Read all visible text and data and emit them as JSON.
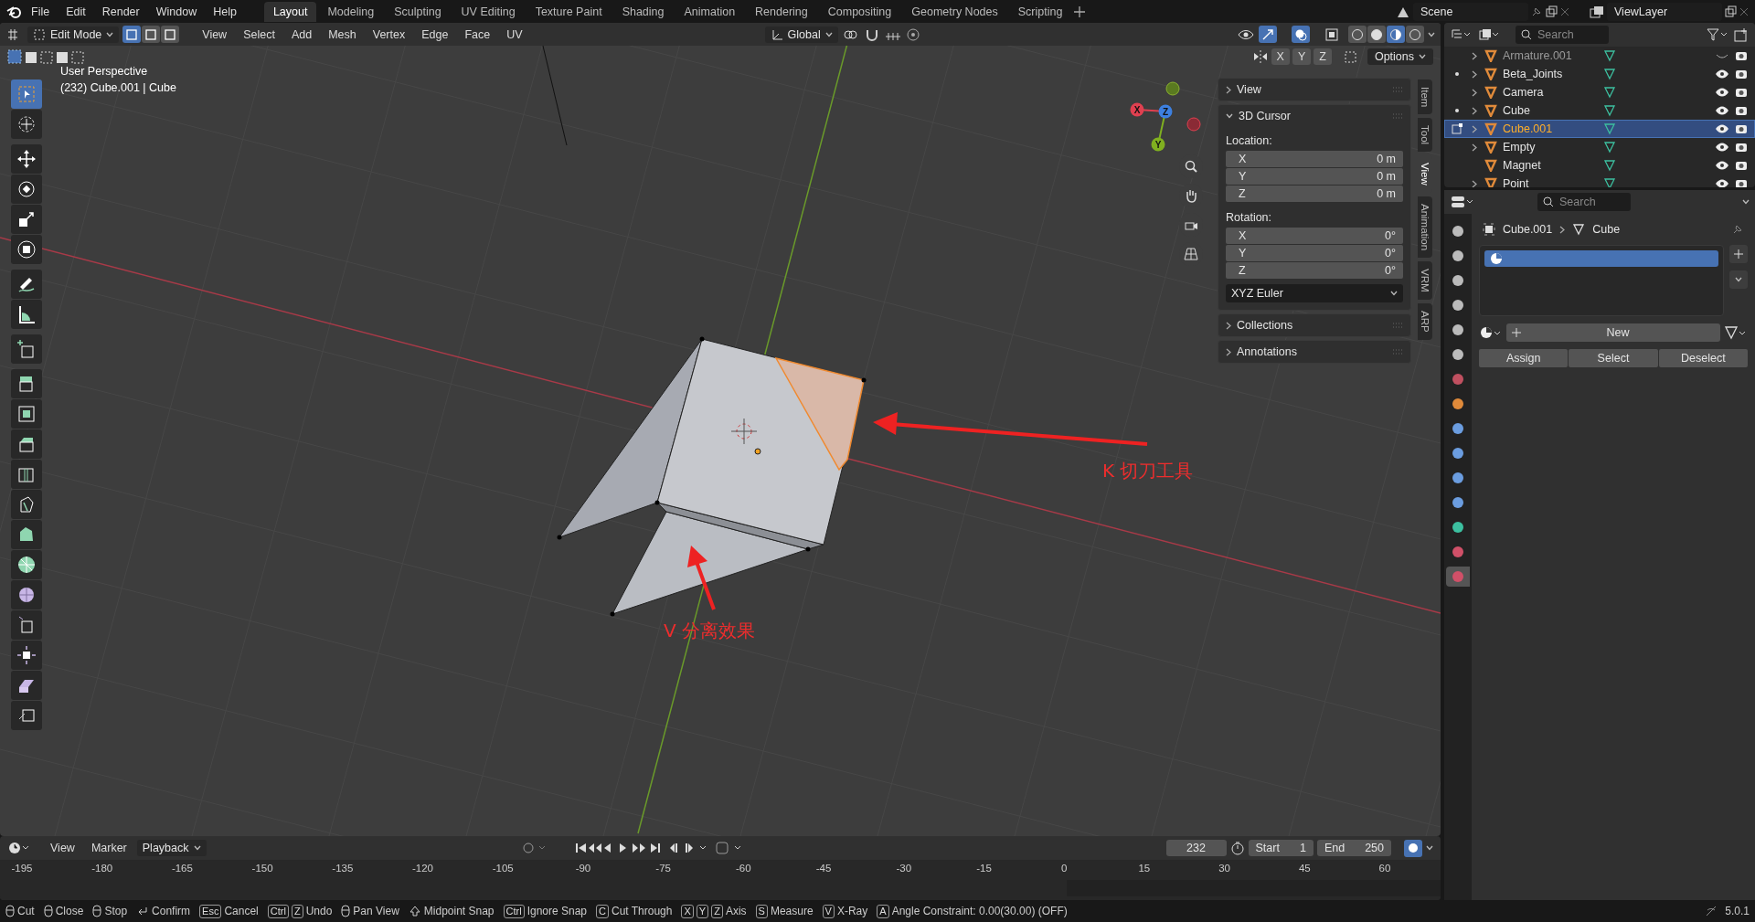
{
  "menu": [
    "File",
    "Edit",
    "Render",
    "Window",
    "Help"
  ],
  "workspaces": [
    {
      "label": "Layout",
      "selected": true
    },
    {
      "label": "Modeling",
      "selected": false
    },
    {
      "label": "Sculpting",
      "selected": false
    },
    {
      "label": "UV Editing",
      "selected": false
    },
    {
      "label": "Texture Paint",
      "selected": false
    },
    {
      "label": "Shading",
      "selected": false
    },
    {
      "label": "Animation",
      "selected": false
    },
    {
      "label": "Rendering",
      "selected": false
    },
    {
      "label": "Compositing",
      "selected": false
    },
    {
      "label": "Geometry Nodes",
      "selected": false
    },
    {
      "label": "Scripting",
      "selected": false
    }
  ],
  "scene": "Scene",
  "view_layer": "ViewLayer",
  "viewport": {
    "mode": "Edit Mode",
    "select_modes": [
      {
        "selected": true
      },
      {
        "selected": false
      },
      {
        "selected": false
      }
    ],
    "menus": [
      "View",
      "Select",
      "Add",
      "Mesh",
      "Vertex",
      "Edge",
      "Face",
      "UV"
    ],
    "orientation": "Global",
    "gizmos_on": true,
    "overlays_on": true,
    "shading": [
      {
        "selected": false
      },
      {
        "selected": false
      },
      {
        "selected": true
      },
      {
        "selected": false
      }
    ],
    "mirror_axes": [
      "X",
      "Y",
      "Z"
    ],
    "options": "Options",
    "view_name": "User Perspective",
    "object_info": "(232) Cube.001 | Cube",
    "gizmo_axes": [
      "X",
      "Y",
      "Z"
    ],
    "annotations": [
      "K 切刀工具",
      "V 分离效果"
    ],
    "tools": [
      {
        "selected": true
      },
      {
        "selected": false
      },
      {
        "selected": false
      },
      {
        "selected": false
      },
      {
        "selected": false
      },
      {
        "selected": false
      },
      {
        "selected": false
      },
      {
        "selected": false
      },
      {
        "selected": false
      },
      {
        "selected": false
      },
      {
        "selected": false
      },
      {
        "selected": false
      },
      {
        "selected": false
      },
      {
        "selected": false
      },
      {
        "selected": false
      },
      {
        "selected": false
      },
      {
        "selected": false
      },
      {
        "selected": false
      },
      {
        "selected": false
      },
      {
        "selected": false
      },
      {
        "selected": false
      }
    ],
    "sidebar": {
      "tabs": [
        {
          "label": "Item",
          "selected": false
        },
        {
          "label": "Tool",
          "selected": false
        },
        {
          "label": "View",
          "selected": true
        },
        {
          "label": "Animation",
          "selected": false
        },
        {
          "label": "VRM",
          "selected": false
        },
        {
          "label": "ARP",
          "selected": false
        }
      ],
      "sections": [
        {
          "title": "View",
          "expanded": false
        },
        {
          "title": "3D Cursor",
          "expanded": true,
          "groups": [
            {
              "label": "Location:",
              "rows": [
                {
                  "axis": "X",
                  "value": "0 m"
                },
                {
                  "axis": "Y",
                  "value": "0 m"
                },
                {
                  "axis": "Z",
                  "value": "0 m"
                }
              ]
            },
            {
              "label": "Rotation:",
              "rows": [
                {
                  "axis": "X",
                  "value": "0°"
                },
                {
                  "axis": "Y",
                  "value": "0°"
                },
                {
                  "axis": "Z",
                  "value": "0°"
                }
              ]
            }
          ],
          "rotation_mode": "XYZ Euler"
        },
        {
          "title": "Collections",
          "expanded": false
        },
        {
          "title": "Annotations",
          "expanded": false
        }
      ]
    }
  },
  "outliner": {
    "search_placeholder": "Search",
    "items": [
      {
        "name": "Armature.001",
        "selected": false,
        "visible": false,
        "expandable": true,
        "dot": false,
        "editing": false
      },
      {
        "name": "Beta_Joints",
        "selected": false,
        "visible": true,
        "expandable": true,
        "dot": true,
        "editing": false
      },
      {
        "name": "Camera",
        "selected": false,
        "visible": true,
        "expandable": true,
        "dot": false,
        "editing": false
      },
      {
        "name": "Cube",
        "selected": false,
        "visible": true,
        "expandable": true,
        "dot": true,
        "editing": false
      },
      {
        "name": "Cube.001",
        "selected": true,
        "visible": true,
        "expandable": true,
        "dot": false,
        "editing": true
      },
      {
        "name": "Empty",
        "selected": false,
        "visible": true,
        "expandable": true,
        "dot": false,
        "editing": false
      },
      {
        "name": "Magnet",
        "selected": false,
        "visible": true,
        "expandable": false,
        "dot": false,
        "editing": false
      },
      {
        "name": "Point",
        "selected": false,
        "visible": true,
        "expandable": true,
        "dot": false,
        "editing": false
      }
    ]
  },
  "properties": {
    "search_placeholder": "Search",
    "object": "Cube.001",
    "data": "Cube",
    "slots": [
      {
        "selected": true
      }
    ],
    "new_label": "New",
    "buttons": [
      "Assign",
      "Select",
      "Deselect"
    ],
    "tabs": [
      {
        "selected": false
      },
      {
        "selected": false
      },
      {
        "selected": false
      },
      {
        "selected": false
      },
      {
        "selected": false
      },
      {
        "selected": false
      },
      {
        "selected": false
      },
      {
        "selected": false
      },
      {
        "selected": false
      },
      {
        "selected": false
      },
      {
        "selected": false
      },
      {
        "selected": false
      },
      {
        "selected": false
      },
      {
        "selected": false
      },
      {
        "selected": true
      }
    ]
  },
  "timeline": {
    "menus": [
      "View",
      "Marker",
      "Playback"
    ],
    "frame": "232",
    "start_label": "Start",
    "start": "1",
    "end_label": "End",
    "end": "250",
    "ruler": [
      "-195",
      "-180",
      "-165",
      "-150",
      "-135",
      "-120",
      "-105",
      "-90",
      "-75",
      "-60",
      "-45",
      "-30",
      "-15",
      "0",
      "15",
      "30",
      "45",
      "60"
    ]
  },
  "status_bar": {
    "items": [
      {
        "kind": "mouse",
        "label": "Cut"
      },
      {
        "kind": "mouse",
        "label": "Close"
      },
      {
        "kind": "mouse",
        "label": "Stop"
      },
      {
        "kind": "enter",
        "label": "Confirm"
      },
      {
        "kind": "keys",
        "keys": [
          "Esc"
        ],
        "label": "Cancel"
      },
      {
        "kind": "keys",
        "keys": [
          "Ctrl",
          "Z"
        ],
        "label": "Undo"
      },
      {
        "kind": "mouse",
        "label": "Pan View"
      },
      {
        "kind": "shift",
        "label": "Midpoint Snap"
      },
      {
        "kind": "keys",
        "keys": [
          "Ctrl"
        ],
        "label": "Ignore Snap"
      },
      {
        "kind": "keys",
        "keys": [
          "C"
        ],
        "label": "Cut Through"
      },
      {
        "kind": "keys",
        "keys": [
          "X",
          "Y",
          "Z"
        ],
        "label": "Axis"
      },
      {
        "kind": "keys",
        "keys": [
          "S"
        ],
        "label": "Measure"
      },
      {
        "kind": "keys",
        "keys": [
          "V"
        ],
        "label": "X-Ray"
      },
      {
        "kind": "keys",
        "keys": [
          "A"
        ],
        "label": "Angle Constraint: 0.00(30.00) (OFF)"
      }
    ],
    "version": "5.0.1"
  }
}
